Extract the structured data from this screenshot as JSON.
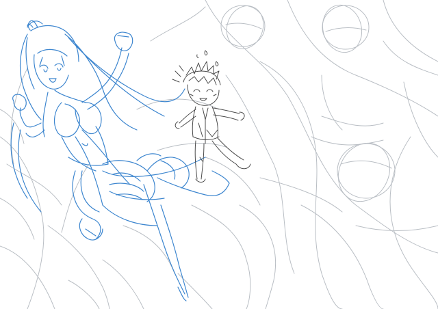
{
  "canvas": {
    "background": "#ffffff",
    "colors": {
      "rough_sketch": "#b9bec4",
      "figure_sketch": "#3d86cf",
      "lineart": "#4a4a4a"
    }
  },
  "layers": [
    {
      "name": "rough-background-layer",
      "color": "gray"
    },
    {
      "name": "girl-figure-layer",
      "color": "blue"
    },
    {
      "name": "chibi-boy-layer",
      "color": "dark-gray"
    }
  ]
}
